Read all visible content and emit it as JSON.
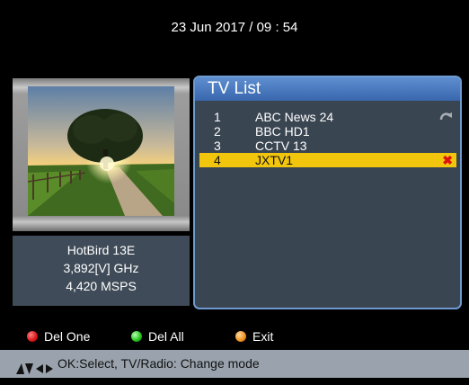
{
  "header": {
    "datetime": "23 Jun 2017 / 09 : 54"
  },
  "satellite": {
    "name": "HotBird 13E",
    "frequency": "3,892[V] GHz",
    "symbol_rate": "4,420 MSPS"
  },
  "list": {
    "title": "TV List",
    "items": [
      {
        "num": "1",
        "name": "ABC News 24",
        "mark": "move-icon"
      },
      {
        "num": "2",
        "name": "BBC HD1",
        "mark": ""
      },
      {
        "num": "3",
        "name": "CCTV 13",
        "mark": ""
      },
      {
        "num": "4",
        "name": "JXTV1",
        "mark": "delete-icon",
        "selected": true
      }
    ]
  },
  "keys": {
    "red_label": "Del One",
    "green_label": "Del All",
    "orange_label": "Exit"
  },
  "help": {
    "text": "OK:Select, TV/Radio: Change mode"
  },
  "colors": {
    "panel_border": "#6e9ad2",
    "header_bar": "#3867ae",
    "selected_row": "#f3c60e",
    "delete_mark": "#e01010"
  }
}
